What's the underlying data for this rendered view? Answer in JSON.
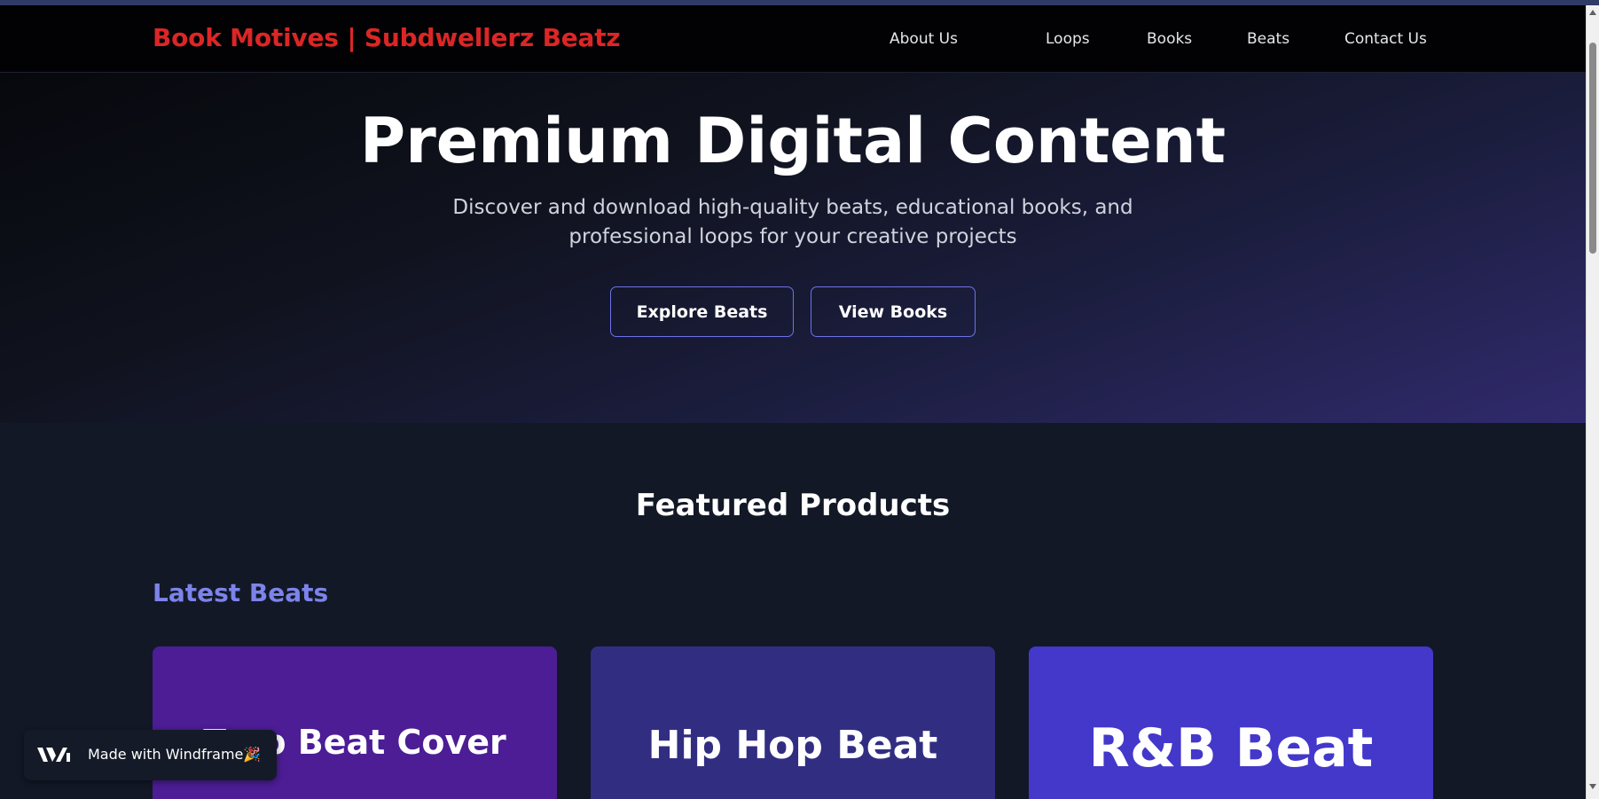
{
  "navbar": {
    "brand": "Book Motives | Subdwellerz Beatz",
    "links": [
      "About Us",
      "Loops",
      "Books",
      "Beats",
      "Contact Us"
    ]
  },
  "hero": {
    "title": "Premium Digital Content",
    "subtitle": "Discover and download high-quality beats, educational books, and professional loops for your creative projects",
    "buttons": [
      "Explore Beats",
      "View Books"
    ]
  },
  "featured": {
    "title": "Featured Products",
    "beats_heading": "Latest Beats",
    "cards": [
      {
        "label": "Trap Beat Cover",
        "color": "#4c1d95"
      },
      {
        "label": "Hip Hop Beat",
        "color": "#312e81"
      },
      {
        "label": "R&B Beat",
        "color": "#4338ca"
      }
    ]
  },
  "badge": {
    "text": "Made with Windframe",
    "emoji": "🎉"
  },
  "colors": {
    "brand": "#dc2626",
    "accent": "#7c83ea",
    "button_border": "#6d72e8",
    "background": "#121826"
  }
}
